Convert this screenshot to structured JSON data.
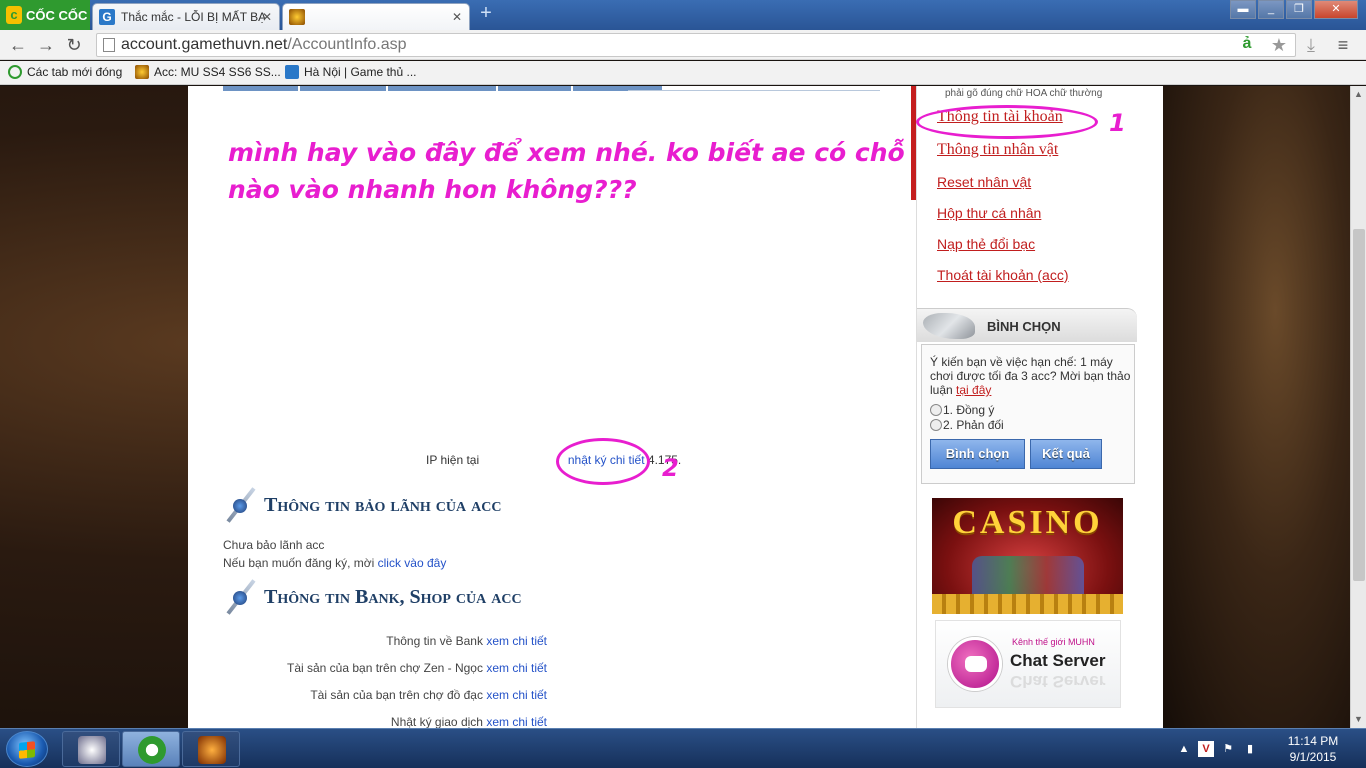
{
  "browser": {
    "brand": "CỐC CỐC",
    "tabs": [
      {
        "title": "Thắc mắc - LỖI BỊ MẤT BẠC"
      },
      {
        "title": ""
      }
    ],
    "url_host": "account.gamethuvn.net",
    "url_path": "/AccountInfo.asp",
    "bookmarks": [
      {
        "label": "Các tab mới đóng"
      },
      {
        "label": "Acc: MU SS4 SS6 SS..."
      },
      {
        "label": "Hà Nội | Game thủ ..."
      }
    ]
  },
  "page": {
    "note": "mình hay vào đây để xem nhé. ko biết ae có chỗ nào vào nhanh hon không???",
    "ip": {
      "label": "IP hiện tại",
      "link": "nhật ký chi tiết",
      "value": "4.175."
    },
    "guarantee": {
      "title": "Thông tin bảo lãnh của acc",
      "status": "Chưa bảo lãnh acc",
      "register_text": "Nếu bạn muốn đăng ký, mời",
      "register_link": "click vào đây"
    },
    "bank": {
      "title": "Thông tin Bank, Shop của acc",
      "rows": [
        {
          "label": "Thông tin về Bank",
          "link": "xem chi tiết"
        },
        {
          "label": "Tài sản của bạn trên chợ Zen - Ngọc",
          "link": "xem chi tiết"
        },
        {
          "label": "Tài sản của bạn trên chợ đồ đạc",
          "link": "xem chi tiết"
        },
        {
          "label": "Nhật ký giao dịch",
          "link": "xem chi tiết"
        }
      ]
    }
  },
  "sidebar": {
    "hint": "phải gõ đúng chữ HOA chữ thường",
    "menu": [
      {
        "label": "Thông tin tài khoản"
      },
      {
        "label": "Thông tin nhân vật"
      },
      {
        "label": "Reset nhân vật"
      },
      {
        "label": "Hộp thư cá nhân"
      },
      {
        "label": "Nạp thẻ đổi bạc"
      },
      {
        "label": "Thoát tài khoản (acc)"
      }
    ],
    "vote": {
      "title": "BÌNH CHỌN",
      "question": "Ý kiến bạn về việc hạn chế: 1 máy chơi được tối đa 3 acc? Mời bạn thảo luận",
      "question_link": "tại đây",
      "options": [
        "1. Đồng ý",
        "2. Phản đối"
      ],
      "vote_button": "Bình chọn",
      "result_button": "Kết quả"
    },
    "casino_banner": "CASINO",
    "chat_banner": {
      "caption": "Kênh thế giới MUHN",
      "title": "Chat Server"
    }
  },
  "annotations": {
    "mark1": "1",
    "mark2": "2",
    "color": "#e81ecf"
  },
  "taskbar": {
    "time": "11:14 PM",
    "date": "9/1/2015"
  }
}
